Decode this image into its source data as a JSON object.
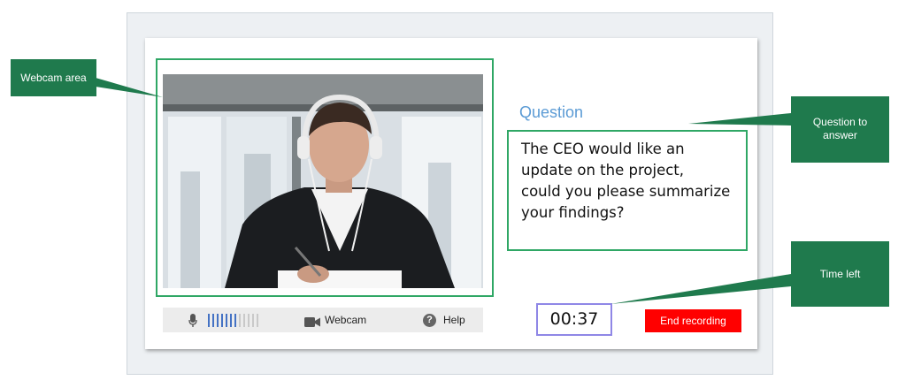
{
  "question": {
    "title": "Question",
    "lines": [
      "The CEO would like an",
      "update on the project,",
      "could you please summarize",
      "your findings?"
    ]
  },
  "controls": {
    "mic_icon": "microphone-icon",
    "level_bars_active": 7,
    "level_bars_total": 12,
    "webcam_icon": "video-camera-icon",
    "webcam_label": "Webcam",
    "help_icon": "question-circle-icon",
    "help_label": "Help"
  },
  "timer": {
    "value": "00:37"
  },
  "end_button": {
    "label": "End recording"
  },
  "annotations": {
    "webcam_area": "Webcam area",
    "question_line1": "Question to",
    "question_line2": "answer",
    "time_left": "Time left"
  },
  "colors": {
    "accent_green": "#2fa765",
    "callout_green": "#1f7a4d",
    "question_blue": "#5b9bd5",
    "timer_border": "#8f87e6",
    "end_red": "#ff0000",
    "level_active": "#4472c4",
    "level_inactive": "#c9c9c9"
  }
}
